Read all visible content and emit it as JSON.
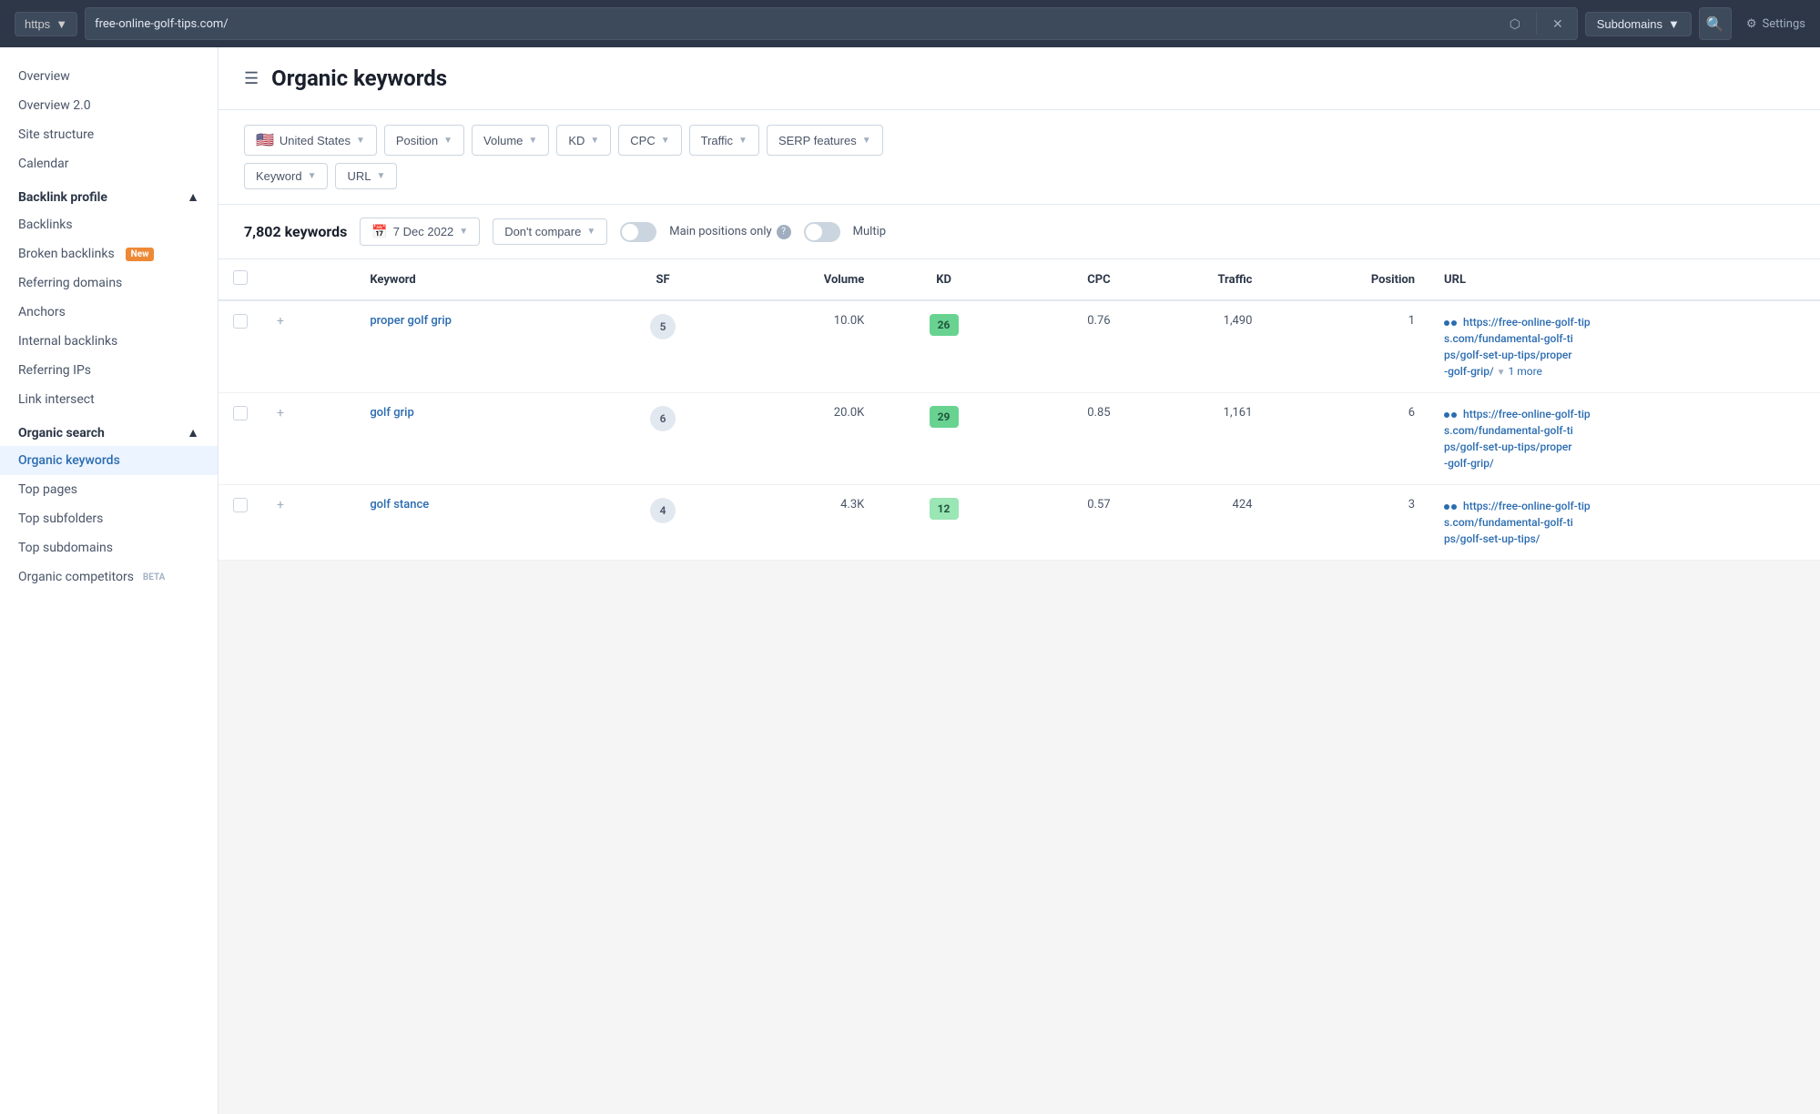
{
  "topbar": {
    "protocol": "https",
    "protocol_arrow": "▼",
    "url": "free-online-golf-tips.com/",
    "subdomains_label": "Subdomains",
    "settings_label": "Settings"
  },
  "sidebar": {
    "top_items": [
      {
        "label": "Overview",
        "id": "overview"
      },
      {
        "label": "Overview 2.0",
        "id": "overview2"
      },
      {
        "label": "Site structure",
        "id": "site-structure"
      },
      {
        "label": "Calendar",
        "id": "calendar"
      }
    ],
    "sections": [
      {
        "title": "Backlink profile",
        "id": "backlink-profile",
        "items": [
          {
            "label": "Backlinks",
            "id": "backlinks",
            "badge": null
          },
          {
            "label": "Broken backlinks",
            "id": "broken-backlinks",
            "badge": "New"
          },
          {
            "label": "Referring domains",
            "id": "referring-domains",
            "badge": null
          },
          {
            "label": "Anchors",
            "id": "anchors",
            "badge": null
          },
          {
            "label": "Internal backlinks",
            "id": "internal-backlinks",
            "badge": null
          },
          {
            "label": "Referring IPs",
            "id": "referring-ips",
            "badge": null
          },
          {
            "label": "Link intersect",
            "id": "link-intersect",
            "badge": null
          }
        ]
      },
      {
        "title": "Organic search",
        "id": "organic-search",
        "items": [
          {
            "label": "Organic keywords",
            "id": "organic-keywords",
            "badge": null,
            "active": true
          },
          {
            "label": "Top pages",
            "id": "top-pages",
            "badge": null
          },
          {
            "label": "Top subfolders",
            "id": "top-subfolders",
            "badge": null
          },
          {
            "label": "Top subdomains",
            "id": "top-subdomains",
            "badge": null
          },
          {
            "label": "Organic competitors",
            "id": "organic-competitors",
            "badge": "BETA"
          }
        ]
      }
    ]
  },
  "page": {
    "title": "Organic keywords",
    "filters": {
      "row1": [
        {
          "label": "United States",
          "id": "country-filter",
          "flag": "🇺🇸"
        },
        {
          "label": "Position",
          "id": "position-filter"
        },
        {
          "label": "Volume",
          "id": "volume-filter"
        },
        {
          "label": "KD",
          "id": "kd-filter"
        },
        {
          "label": "CPC",
          "id": "cpc-filter"
        },
        {
          "label": "Traffic",
          "id": "traffic-filter"
        },
        {
          "label": "SERP features",
          "id": "serp-filter"
        }
      ],
      "row2": [
        {
          "label": "Keyword",
          "id": "keyword-filter"
        },
        {
          "label": "URL",
          "id": "url-filter"
        }
      ]
    },
    "toolbar": {
      "keywords_count": "7,802 keywords",
      "date_label": "7 Dec 2022",
      "compare_label": "Don't compare",
      "main_positions_label": "Main positions only",
      "multi_label": "Multip"
    },
    "table": {
      "columns": [
        "",
        "",
        "Keyword",
        "SF",
        "Volume",
        "KD",
        "CPC",
        "Traffic",
        "Position",
        "URL"
      ],
      "rows": [
        {
          "keyword": "proper golf grip",
          "sf": "5",
          "volume": "10.0K",
          "kd": "26",
          "kd_class": "kd-green",
          "cpc": "0.76",
          "traffic": "1,490",
          "position": "1",
          "url": "https://free-online-golf-tips.com/fundamental-golf-tips/golf-set-up-tips/proper-golf-grip/",
          "url_short": "https://free-online-golf-tip\ns.com/fundamental-golf-ti\nps/golf-set-up-tips/proper\n-golf-grip/",
          "more": "▼ 1 more",
          "has_more": true
        },
        {
          "keyword": "golf grip",
          "sf": "6",
          "volume": "20.0K",
          "kd": "29",
          "kd_class": "kd-green",
          "cpc": "0.85",
          "traffic": "1,161",
          "position": "6",
          "url": "https://free-online-golf-tips.com/fundamental-golf-tips/golf-set-up-tips/proper-golf-grip/",
          "url_short": "https://free-online-golf-tip\ns.com/fundamental-golf-ti\nps/golf-set-up-tips/proper\n-golf-grip/",
          "more": null,
          "has_more": false
        },
        {
          "keyword": "golf stance",
          "sf": "4",
          "volume": "4.3K",
          "kd": "12",
          "kd_class": "kd-light-green",
          "cpc": "0.57",
          "traffic": "424",
          "position": "3",
          "url": "https://free-online-golf-tips.com/fundamental-golf-tips/golf-set-up-tips/",
          "url_short": "https://free-online-golf-tip\ns.com/fundamental-golf-ti\nps/golf-set-up-tips/",
          "more": null,
          "has_more": false
        }
      ]
    }
  }
}
